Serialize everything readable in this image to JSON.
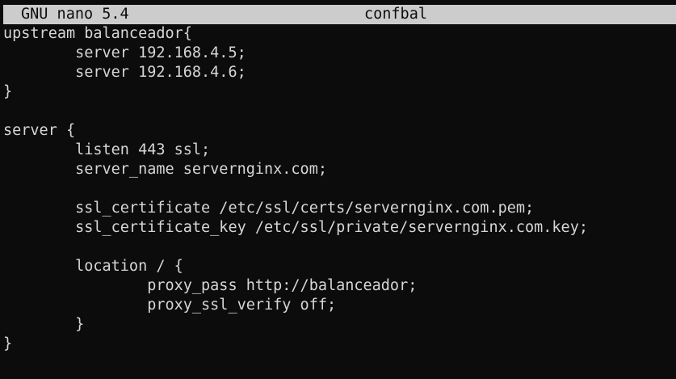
{
  "titlebar": {
    "app_version": "GNU nano 5.4",
    "filename": "confbal"
  },
  "editor": {
    "lines": [
      "upstream balanceador{",
      "        server 192.168.4.5;",
      "        server 192.168.4.6;",
      "}",
      "",
      "server {",
      "        listen 443 ssl;",
      "        server_name servernginx.com;",
      "",
      "        ssl_certificate /etc/ssl/certs/servernginx.com.pem;",
      "        ssl_certificate_key /etc/ssl/private/servernginx.com.key;",
      "",
      "        location / {",
      "                proxy_pass http://balanceador;",
      "                proxy_ssl_verify off;",
      "        }",
      "}"
    ]
  },
  "colors": {
    "background": "#0c0c0c",
    "foreground": "#d6d6d6",
    "titlebar_bg": "#cccccc",
    "titlebar_fg": "#0c0c0c"
  }
}
